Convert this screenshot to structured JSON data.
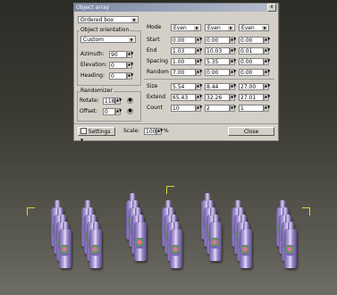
{
  "window": {
    "title": "Object array",
    "close_glyph": "x"
  },
  "left": {
    "type_select": "Ordered box",
    "orientation_group": "Object orientation",
    "orientation_select": "Custom",
    "azimuth": {
      "label": "Azimuth:",
      "value": "90"
    },
    "elevation": {
      "label": "Elevation:",
      "value": "0"
    },
    "heading": {
      "label": "Heading:",
      "value": "0"
    },
    "randomizer_group": "Randomizer",
    "rotate": {
      "label": "Rotate:",
      "value": "118"
    },
    "offset": {
      "label": "Offset:",
      "value": "0"
    }
  },
  "grid": {
    "mode_label": "Mode",
    "modes": [
      "Even",
      "Even",
      "Even"
    ],
    "rows_top": [
      {
        "label": "Start",
        "values": [
          "0.00",
          "0.00",
          "0.00"
        ]
      },
      {
        "label": "End",
        "values": [
          "1.03",
          "10.03",
          "0.01"
        ]
      },
      {
        "label": "Spacing",
        "values": [
          "1.00",
          "5.35",
          "0.00"
        ]
      },
      {
        "label": "Random",
        "values": [
          "7.00",
          "0.00",
          "0.00"
        ]
      }
    ],
    "rows_bottom": [
      {
        "label": "Size",
        "values": [
          "5.54",
          "8.44",
          "27.00"
        ]
      },
      {
        "label": "Extend",
        "values": [
          "65.43",
          "32.26",
          "27.01"
        ]
      },
      {
        "label": "Count",
        "values": [
          "10",
          "2",
          "1"
        ]
      }
    ]
  },
  "footer": {
    "settings_label": "Settings",
    "scale_label": "Scale:",
    "scale_value": "100",
    "scale_unit": "%",
    "close_label": "Close"
  }
}
